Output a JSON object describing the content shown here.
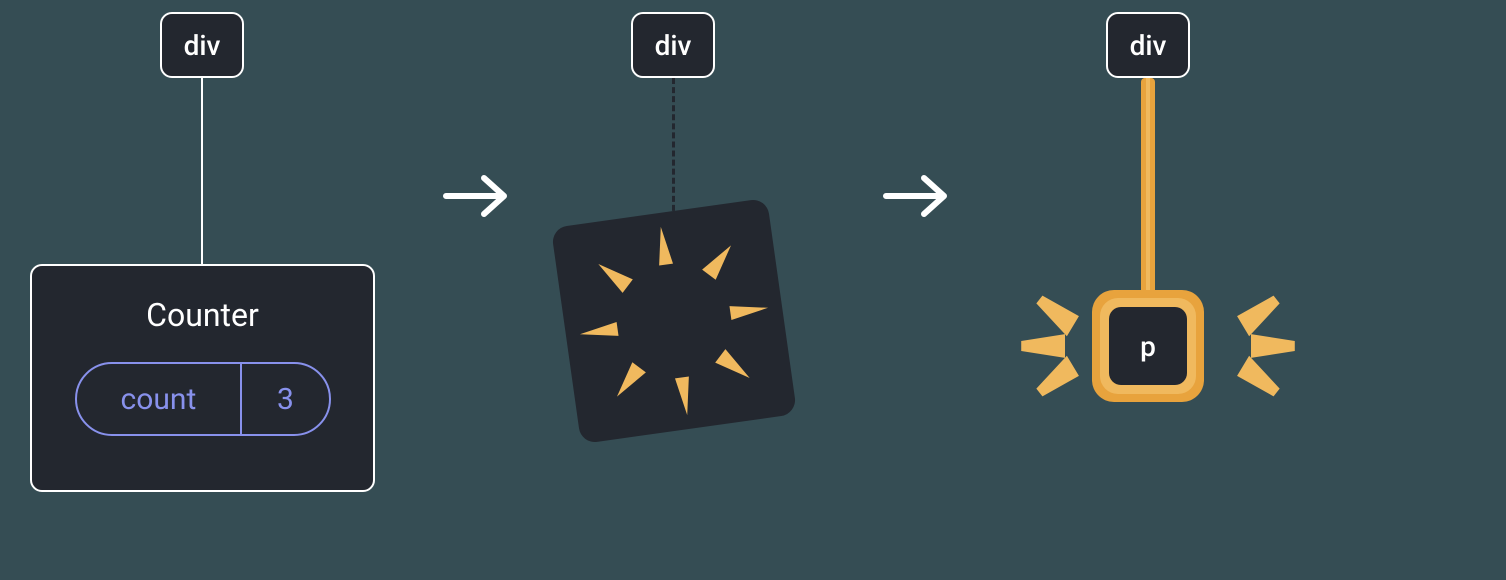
{
  "stage1": {
    "parent_label": "div",
    "component_name": "Counter",
    "state_key": "count",
    "state_value": "3"
  },
  "stage2": {
    "parent_label": "div"
  },
  "stage3": {
    "parent_label": "div",
    "new_element_label": "p"
  },
  "colors": {
    "background": "#354d54",
    "node_fill": "#23272f",
    "node_border": "#ffffff",
    "state_accent": "#8891ec",
    "highlight": "#e8a33d",
    "highlight_inner": "#f0b95e"
  },
  "concept": "When a React component (Counter) is removed from the tree, its state is destroyed; mounting a different element (p) in the same position creates fresh state."
}
